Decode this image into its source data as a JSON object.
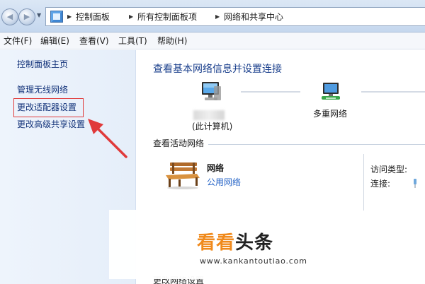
{
  "address_bar": {
    "breadcrumbs": [
      "控制面板",
      "所有控制面板项",
      "网络和共享中心"
    ]
  },
  "menu": {
    "items": [
      "文件(F)",
      "编辑(E)",
      "查看(V)",
      "工具(T)",
      "帮助(H)"
    ]
  },
  "sidebar": {
    "items": [
      {
        "label": "控制面板主页"
      },
      {
        "label": "管理无线网络"
      },
      {
        "label": "更改适配器设置",
        "highlighted": true
      },
      {
        "label": "更改高级共享设置"
      }
    ]
  },
  "main": {
    "title": "查看基本网络信息并设置连接",
    "map": {
      "this_computer_label": "(此计算机)",
      "network_label": "多重网络"
    },
    "active_networks": {
      "heading": "查看活动网络",
      "network_name": "网络",
      "network_type": "公用网络",
      "access_type_label": "访问类型:",
      "connection_label": "连接:"
    },
    "bottom_peek": "更改网络设置"
  },
  "watermark": {
    "logo_part1": "看看",
    "logo_part2": "头条",
    "url": "www.kankantoutiao.com"
  },
  "colors": {
    "link": "#13337a",
    "title": "#1a3f8c",
    "highlight": "#e03a3a",
    "watermark_accent": "#f08a1c"
  }
}
